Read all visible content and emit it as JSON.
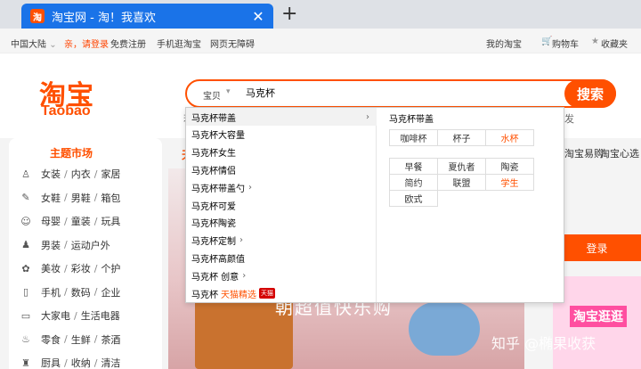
{
  "browser": {
    "tab_favicon": "淘",
    "tab_title": "淘宝网 - 淘！我喜欢",
    "tab_close": "✕",
    "new_tab": "+"
  },
  "sitenav": {
    "region": "中国大陆",
    "greeting": "亲，请登录",
    "register": "免费注册",
    "mobile": "手机逛淘宝",
    "accessible": "网页无障碍",
    "my_taobao": "我的淘宝",
    "cart": "购物车",
    "favorites": "收藏夹"
  },
  "logo": {
    "cn": "淘宝",
    "en": "Taobao"
  },
  "search": {
    "category": "宝贝",
    "value": "马克杯",
    "button": "搜索",
    "hot_head": "若",
    "hot_tail": "发"
  },
  "suggestions": {
    "items": [
      {
        "label": "马克杯带盖",
        "has_arrow": true
      },
      {
        "label": "马克杯大容量"
      },
      {
        "label": "马克杯女生"
      },
      {
        "label": "马克杯情侣"
      },
      {
        "label": "马克杯带盖勺",
        "has_arrow": true
      },
      {
        "label": "马克杯可爱"
      },
      {
        "label": "马克杯陶瓷"
      },
      {
        "label": "马克杯定制",
        "has_arrow": true
      },
      {
        "label": "马克杯高颜值"
      },
      {
        "label": "马克杯 创意",
        "has_arrow": true
      },
      {
        "label": "马克杯",
        "tag": "天猫精选",
        "badge": "天猫"
      }
    ],
    "detail_title": "马克杯带盖",
    "group1": [
      {
        "label": "咖啡杯"
      },
      {
        "label": "杯子"
      },
      {
        "label": "水杯",
        "hot": true
      }
    ],
    "group2": [
      {
        "label": "早餐"
      },
      {
        "label": "夏仇者"
      },
      {
        "label": "陶瓷"
      },
      {
        "label": "简约"
      },
      {
        "label": "联盟"
      },
      {
        "label": "学生",
        "hot": true
      },
      {
        "label": "欧式"
      }
    ]
  },
  "theme_market": {
    "title": "主题市场",
    "rows": [
      {
        "icon": "clothes-icon",
        "glyph": "♙",
        "items": [
          "女装",
          "内衣",
          "家居"
        ]
      },
      {
        "icon": "shoe-icon",
        "glyph": "✎",
        "items": [
          "女鞋",
          "男鞋",
          "箱包"
        ]
      },
      {
        "icon": "baby-icon",
        "glyph": "☺",
        "items": [
          "母婴",
          "童装",
          "玩具"
        ]
      },
      {
        "icon": "tshirt-icon",
        "glyph": "♟",
        "items": [
          "男装",
          "运动户外"
        ]
      },
      {
        "icon": "cosmetics-icon",
        "glyph": "✿",
        "items": [
          "美妆",
          "彩妆",
          "个护"
        ]
      },
      {
        "icon": "phone-icon",
        "glyph": "▯",
        "items": [
          "手机",
          "数码",
          "企业"
        ]
      },
      {
        "icon": "appliance-icon",
        "glyph": "▭",
        "items": [
          "大家电",
          "生活电器"
        ]
      },
      {
        "icon": "food-icon",
        "glyph": "♨",
        "items": [
          "零食",
          "生鲜",
          "茶酒"
        ]
      },
      {
        "icon": "kitchen-icon",
        "glyph": "♜",
        "items": [
          "厨具",
          "收纳",
          "清洁"
        ]
      }
    ]
  },
  "banner": {
    "slogan": "朝超值快乐购"
  },
  "rightnav": {
    "head": "天",
    "link1": "淘宝心选",
    "link2": "淘宝易购",
    "login": "登录",
    "promo": "淘宝逛逛"
  },
  "watermark": "知乎 @椭果收获"
}
